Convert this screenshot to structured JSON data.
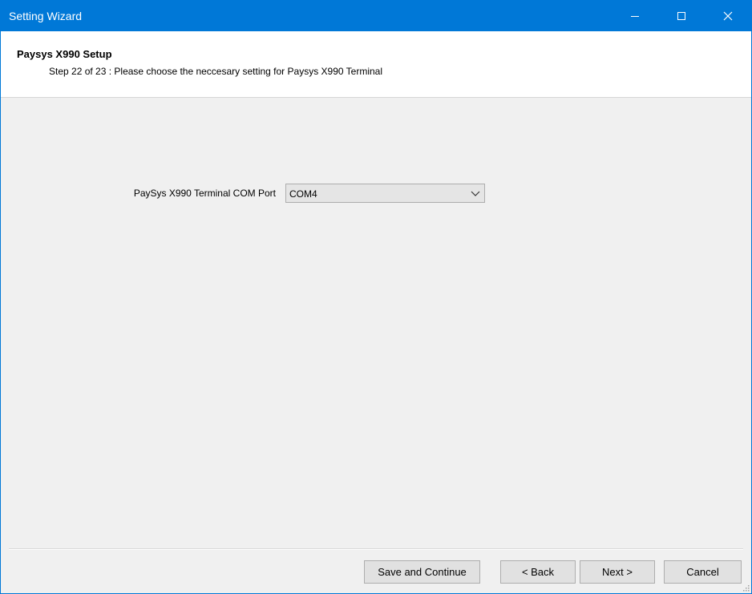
{
  "window": {
    "title": "Setting Wizard"
  },
  "header": {
    "title": "Paysys X990 Setup",
    "subtitle": "Step 22 of 23 : Please choose the neccesary setting for Paysys X990 Terminal"
  },
  "form": {
    "com_port_label": "PaySys X990 Terminal COM Port",
    "com_port_value": "COM4"
  },
  "buttons": {
    "save_continue": "Save and Continue",
    "back": "< Back",
    "next": "Next >",
    "cancel": "Cancel"
  },
  "colors": {
    "titlebar": "#0078d7",
    "body": "#f0f0f0",
    "header": "#ffffff"
  }
}
